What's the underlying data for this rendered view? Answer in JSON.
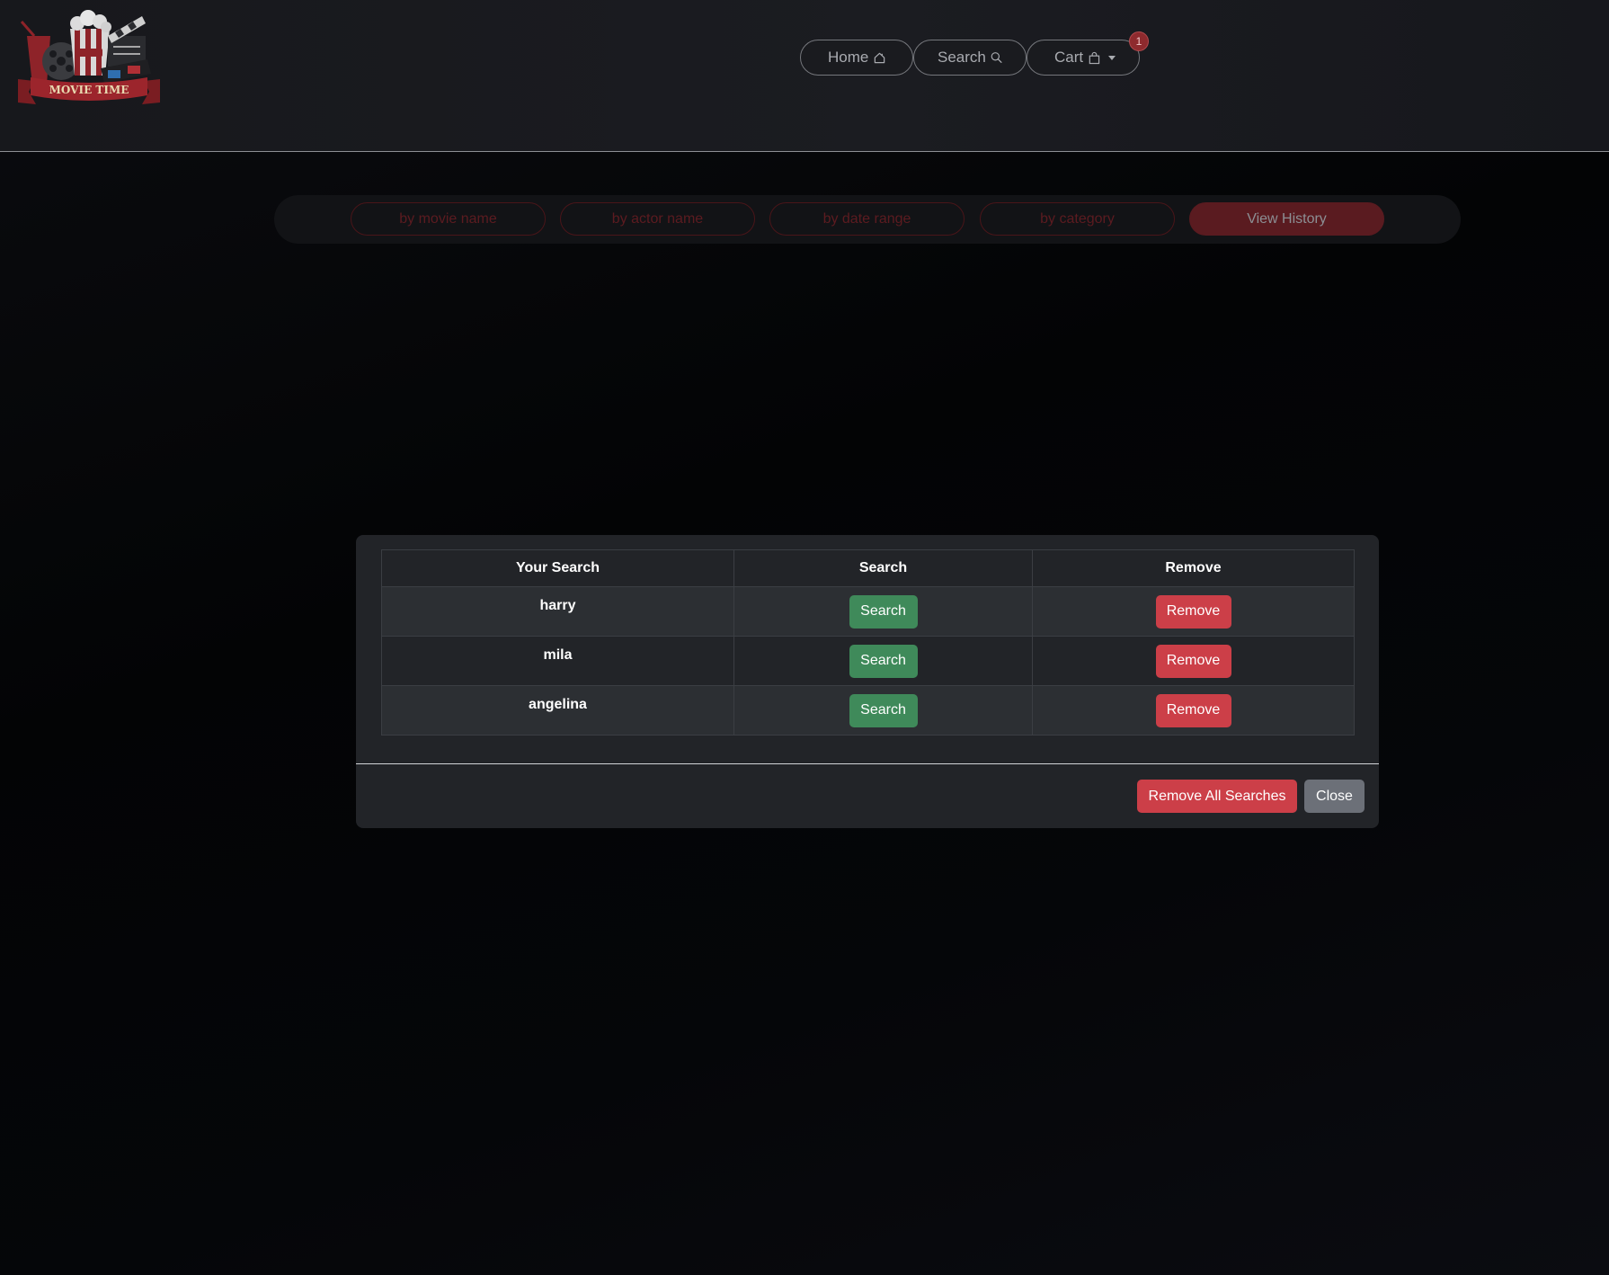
{
  "header": {
    "logo_text": "MOVIE TIME",
    "nav": {
      "home_label": "Home",
      "search_label": "Search",
      "cart_label": "Cart",
      "cart_count": "1"
    }
  },
  "search_types": {
    "by_movie_name": "by movie name",
    "by_actor_name": "by actor name",
    "by_date_range": "by date range",
    "by_category": "by category",
    "view_history": "View History",
    "active": "View History"
  },
  "history_modal": {
    "columns": {
      "your_search": "Your Search",
      "search": "Search",
      "remove": "Remove"
    },
    "rows": [
      {
        "term": "harry",
        "search_label": "Search",
        "remove_label": "Remove"
      },
      {
        "term": "mila",
        "search_label": "Search",
        "remove_label": "Remove"
      },
      {
        "term": "angelina",
        "search_label": "Search",
        "remove_label": "Remove"
      }
    ],
    "footer": {
      "remove_all_label": "Remove All Searches",
      "close_label": "Close"
    }
  },
  "colors": {
    "accent_red": "#cc3f48",
    "search_green": "#3f8a5a",
    "close_gray": "#6c7078",
    "badge_red": "#8e2a2e"
  }
}
